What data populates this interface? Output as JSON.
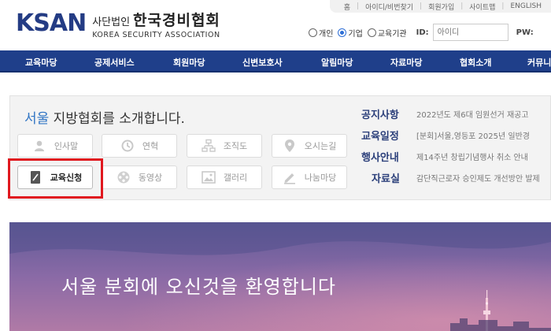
{
  "util_links": [
    "홈",
    "아이디/비번찾기",
    "회원가입",
    "사이트맵",
    "ENGLISH"
  ],
  "logo": {
    "mark": "KSAN",
    "small": "사단법인",
    "big": "한국경비협회",
    "english": "KOREA SECURITY ASSOCIATION"
  },
  "login": {
    "radios": [
      {
        "label": "개인",
        "checked": false
      },
      {
        "label": "기업",
        "checked": true
      },
      {
        "label": "교육기관",
        "checked": false
      }
    ],
    "id_label": "ID:",
    "id_placeholder": "아이디",
    "pw_label": "PW:"
  },
  "nav": [
    "교육마당",
    "공제서비스",
    "회원마당",
    "신변보호사",
    "알림마당",
    "자료마당",
    "협회소개",
    "커뮤니"
  ],
  "intro": {
    "city": "서울",
    "rest": " 지방협회를 소개합니다."
  },
  "quick": [
    {
      "label": "인사말",
      "icon": "person-icon"
    },
    {
      "label": "연혁",
      "icon": "history-icon"
    },
    {
      "label": "조직도",
      "icon": "org-chart-icon"
    },
    {
      "label": "오시는길",
      "icon": "map-pin-icon"
    },
    {
      "label": "교육신청",
      "icon": "document-icon",
      "active": true
    },
    {
      "label": "동영상",
      "icon": "film-reel-icon"
    },
    {
      "label": "갤러리",
      "icon": "gallery-icon"
    },
    {
      "label": "나눔마당",
      "icon": "pencil-icon"
    }
  ],
  "news": [
    {
      "title": "공지사항",
      "text": "2022년도 제6대 임원선거 재공고"
    },
    {
      "title": "교육일정",
      "text": "[분회]서울,영등포 2025년 일반경"
    },
    {
      "title": "행사안내",
      "text": "제14주년 창립기념행사 취소 안내"
    },
    {
      "title": "자료실",
      "text": "감단직근로자 승인제도 개선방안 발제"
    }
  ],
  "banner": {
    "title": "서울 분회에 오신것을 환영합니다"
  },
  "colors": {
    "nav": "#1f3f8a",
    "brand": "#243c84",
    "highlight": "#e0181f",
    "city": "#2f74c4"
  }
}
